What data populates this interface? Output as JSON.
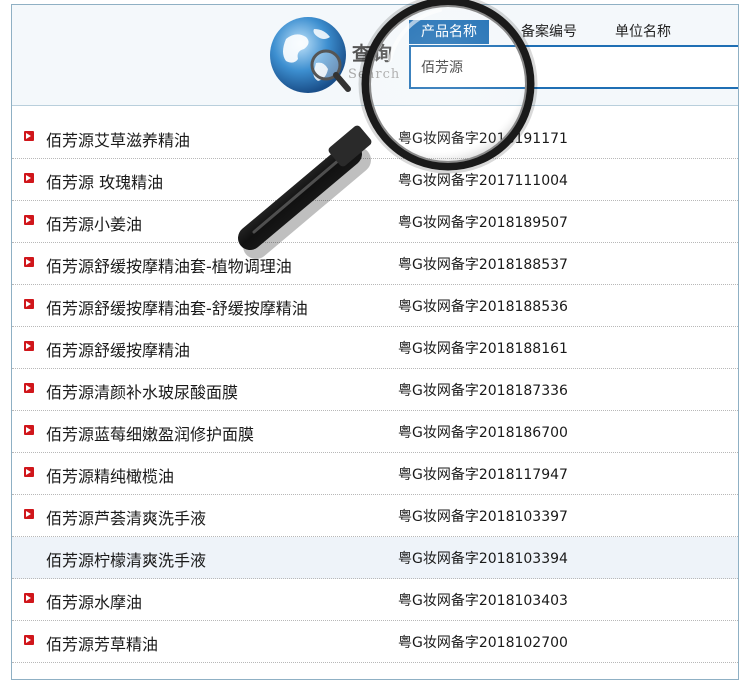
{
  "logo": {
    "title": "查询",
    "subtitle": "Search",
    "globe_icon": "globe-magnifier-icon"
  },
  "tabs": [
    {
      "label": "产品名称",
      "active": true
    },
    {
      "label": "备案编号",
      "active": false
    },
    {
      "label": "单位名称",
      "active": false
    }
  ],
  "search": {
    "value": "佰芳源"
  },
  "colors": {
    "accent": "#1f6fb4",
    "bullet": "#d0161b",
    "row_highlight": "#eef3f9"
  },
  "results": [
    {
      "name": "佰芳源艾草滋养精油",
      "code": "粤G妆网备字2018191171"
    },
    {
      "name": "佰芳源 玫瑰精油",
      "code": "粤G妆网备字2017111004"
    },
    {
      "name": "佰芳源小姜油",
      "code": "粤G妆网备字2018189507"
    },
    {
      "name": "佰芳源舒缓按摩精油套-植物调理油",
      "code": "粤G妆网备字2018188537"
    },
    {
      "name": "佰芳源舒缓按摩精油套-舒缓按摩精油",
      "code": "粤G妆网备字2018188536"
    },
    {
      "name": "佰芳源舒缓按摩精油",
      "code": "粤G妆网备字2018188161"
    },
    {
      "name": "佰芳源清颜补水玻尿酸面膜",
      "code": "粤G妆网备字2018187336"
    },
    {
      "name": "佰芳源蓝莓细嫩盈润修护面膜",
      "code": "粤G妆网备字2018186700"
    },
    {
      "name": "佰芳源精纯橄榄油",
      "code": "粤G妆网备字2018117947"
    },
    {
      "name": "佰芳源芦荟清爽洗手液",
      "code": "粤G妆网备字2018103397"
    },
    {
      "name": "佰芳源柠檬清爽洗手液",
      "code": "粤G妆网备字2018103394",
      "highlighted": true
    },
    {
      "name": "佰芳源水摩油",
      "code": "粤G妆网备字2018103403"
    },
    {
      "name": "佰芳源芳草精油",
      "code": "粤G妆网备字2018102700"
    }
  ]
}
